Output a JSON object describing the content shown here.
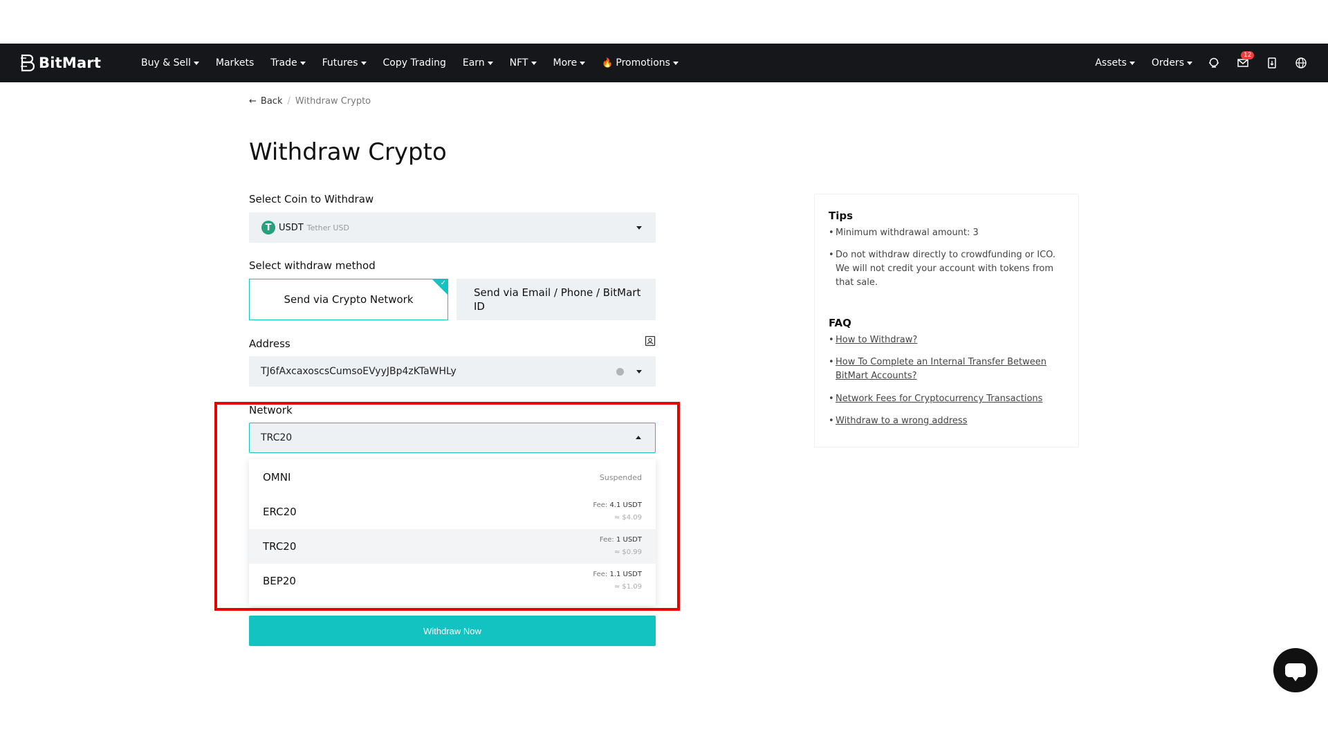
{
  "header": {
    "logo": "BitMart",
    "nav": [
      {
        "label": "Buy & Sell",
        "caret": true
      },
      {
        "label": "Markets",
        "caret": false
      },
      {
        "label": "Trade",
        "caret": true
      },
      {
        "label": "Futures",
        "caret": true
      },
      {
        "label": "Copy Trading",
        "caret": false
      },
      {
        "label": "Earn",
        "caret": true
      },
      {
        "label": "NFT",
        "caret": true
      },
      {
        "label": "More",
        "caret": true
      },
      {
        "label": "Promotions",
        "caret": true
      }
    ],
    "assets": "Assets",
    "orders": "Orders",
    "mail_badge": "12",
    "icons": [
      "support-icon",
      "mail-icon",
      "download-app-icon",
      "globe-icon"
    ]
  },
  "breadcrumb": {
    "back": "Back",
    "separator": "/",
    "current": "Withdraw Crypto"
  },
  "page_title": "Withdraw Crypto",
  "coin_section": {
    "label": "Select Coin to Withdraw",
    "icon_letter": "T",
    "symbol": "USDT",
    "name": "Tether USD"
  },
  "method_section": {
    "label": "Select withdraw method",
    "options": [
      {
        "label": "Send via Crypto Network",
        "selected": true
      },
      {
        "label": "Send via Email / Phone / BitMart ID",
        "selected": false
      }
    ]
  },
  "address_section": {
    "label": "Address",
    "value": "TJ6fAxcaxoscsCumsoEVyyJBp4zKTaWHLy"
  },
  "network_section": {
    "label": "Network",
    "value": "TRC20",
    "options": [
      {
        "name": "OMNI",
        "status": "Suspended"
      },
      {
        "name": "ERC20",
        "fee_label": "Fee:",
        "fee": "4.1 USDT",
        "usd": "≈ $4.09"
      },
      {
        "name": "TRC20",
        "fee_label": "Fee:",
        "fee": "1 USDT",
        "usd": "≈ $0.99",
        "selected": true
      },
      {
        "name": "BEP20",
        "fee_label": "Fee:",
        "fee": "1.1 USDT",
        "usd": "≈ $1.09"
      }
    ]
  },
  "withdraw_button": "Withdraw Now",
  "tips": {
    "title": "Tips",
    "items": [
      "Minimum withdrawal amount: 3",
      "Do not withdraw directly to crowdfunding or ICO. We will not credit your account with tokens from that sale."
    ]
  },
  "faq": {
    "title": "FAQ",
    "links": [
      "How to Withdraw?",
      "How To Complete an Internal Transfer Between BitMart Accounts?",
      "Network Fees for Cryptocurrency Transactions",
      "Withdraw to a wrong address"
    ]
  },
  "colors": {
    "accent": "#13c3c1",
    "header_bg": "#16171a",
    "highlight": "#e60000",
    "usdt": "#26a17b"
  }
}
